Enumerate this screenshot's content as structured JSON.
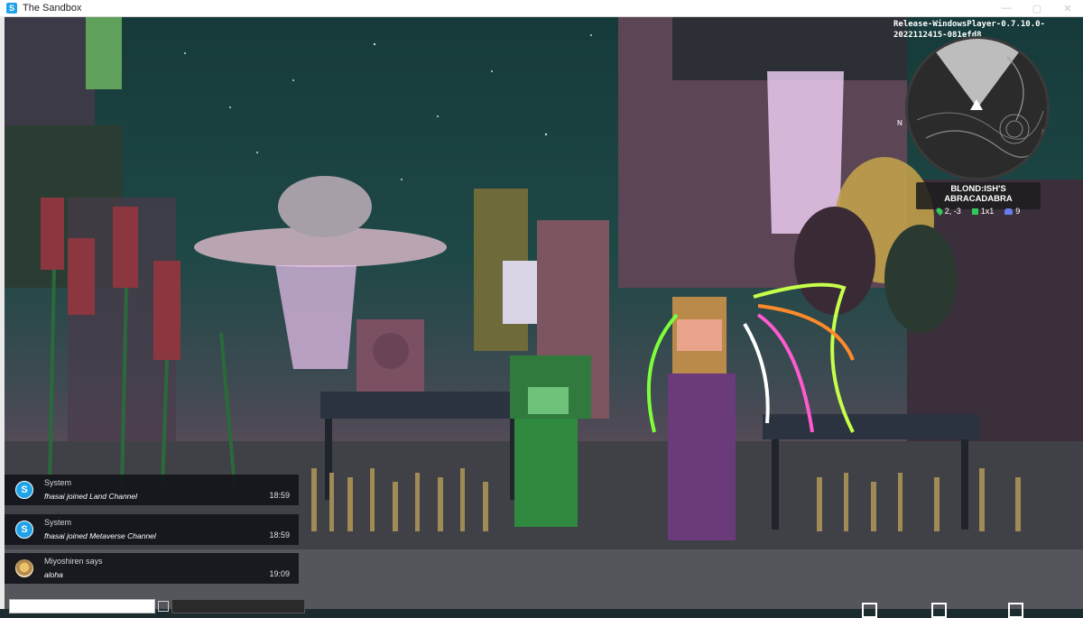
{
  "window": {
    "title": "The Sandbox",
    "app_icon": "S",
    "controls": [
      "—",
      "▢",
      "✕"
    ]
  },
  "hud": {
    "version": "Release-WindowsPlayer-0.7.10.0-2022112415-081efd8",
    "compass": "N",
    "land": {
      "name": "BLOND:ISH'S ABRACADABRA",
      "coords": "2, -3",
      "size": "1x1",
      "players": "9"
    }
  },
  "chat": {
    "messages": [
      {
        "sender": "System",
        "text": "fhasai joined Land Channel",
        "time": "18:59",
        "avatar": "S"
      },
      {
        "sender": "System",
        "text": "fhasai joined Metaverse Channel",
        "time": "18:59",
        "avatar": "S"
      },
      {
        "sender": "Miyoshiren says",
        "text": "aloha",
        "time": "19:09"
      }
    ]
  },
  "colors": {
    "accent": "#1fa3e8",
    "panel": "#12141a",
    "stat_green": "#34c759",
    "stat_players": "#6b7cf0"
  }
}
